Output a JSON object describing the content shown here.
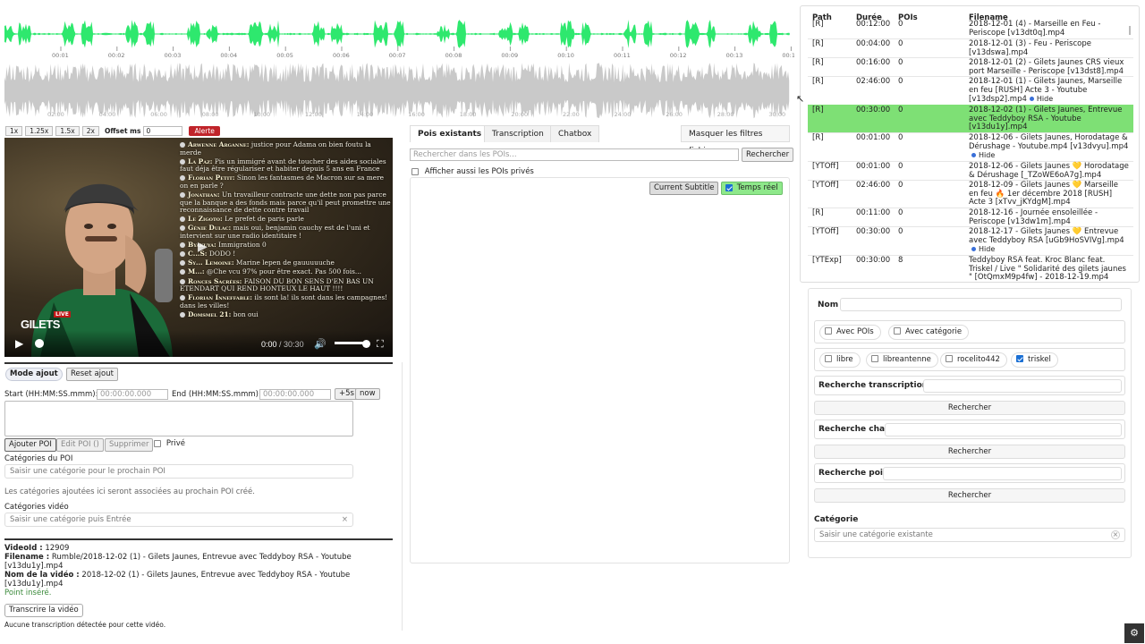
{
  "waveform": {
    "colors": {
      "top": "#2ee86e",
      "bottom": "#c9c9c9"
    },
    "top_ticks": [
      "00:01",
      "00:02",
      "00:03",
      "00:04",
      "00:05",
      "00:06",
      "00:07",
      "00:08",
      "00:09",
      "00:10",
      "00:11",
      "00:12",
      "00:13",
      "00:1"
    ],
    "bottom_ticks": [
      "02:00",
      "04:00",
      "06:00",
      "08:00",
      "10:00",
      "12:00",
      "14:00",
      "16:00",
      "18:00",
      "20:00",
      "22:00",
      "24:00",
      "26:00",
      "28:00",
      "30:00"
    ]
  },
  "speed_bar": {
    "speeds": [
      "1x",
      "1.25x",
      "1.5x",
      "2x"
    ],
    "offset_label": "Offset ms",
    "offset_value": "0",
    "alert_label": "Alerte"
  },
  "video": {
    "chat": [
      {
        "user": "Arwenne Arganne:",
        "text": "justice pour Adama on bien foutu la merde"
      },
      {
        "user": "La Paz:",
        "text": "Pis un immigré avant de toucher des aides sociales faut déja être régulariser et habiter depuis 5 ans en France"
      },
      {
        "user": "Florian Petit:",
        "text": "Sinon les fantasmes de Macron sur sa mere on en parle ?"
      },
      {
        "user": "Jonathan:",
        "text": "Un travailleur contracte une dette non pas parce que la banque a des fonds mais parce qu'il peut promettre une reconnaissance de dette contre travail"
      },
      {
        "user": "Le Zigoto:",
        "text": "Le prefet de paris parle"
      },
      {
        "user": "Génie Dulac:",
        "text": "mais oui, benjamin cauchy est de l'uni et intervient sur une radio identitaire !"
      },
      {
        "user": "Byakuya:",
        "text": "Immigration 0"
      },
      {
        "user": "C...S:",
        "text": "DODO !"
      },
      {
        "user": "Sy... Lemoine:",
        "text": "Marine lepen de gauuuuuche"
      },
      {
        "user": "M...:",
        "text": "@Che vcu 97% pour être exact. Pas 500 fois..."
      },
      {
        "user": "Ronces Sacrées:",
        "text": "FAISON DU BON SENS D'EN BAS UN ETENDART QUI REND HONTEUX LE HAUT !!!!"
      },
      {
        "user": "Florian Inneffable:",
        "text": "ils sont la! ils sont dans les campagnes! dans les villes!"
      },
      {
        "user": "Domsmel 21:",
        "text": "bon oui"
      }
    ],
    "overlay_title": "GILETS",
    "live_badge": "LIVE",
    "time_current": "0:00",
    "time_sep": " / ",
    "time_total": "30:30"
  },
  "form": {
    "mode_label": "Mode ajout",
    "reset_label": "Reset ajout",
    "start_label": "Start (HH:MM:SS.mmm):",
    "start_placeholder": "00:00:00.000",
    "end_label": "End (HH:MM:SS.mmm):",
    "end_placeholder": "00:00:00.000",
    "plus5_label": "+5s",
    "now_label": "now",
    "add_poi_label": "Ajouter POI",
    "edit_poi_label": "Edit POI ()",
    "delete_label": "Supprimer",
    "private_label": "Privé",
    "poi_categories_label": "Catégories du POI",
    "poi_categories_placeholder": "Saisir une catégorie pour le prochain POI",
    "poi_categories_hint": "Les catégories ajoutées ici seront associées au prochain POI créé.",
    "video_categories_label": "Catégories vidéo",
    "video_categories_placeholder": "Saisir une catégorie puis Entrée"
  },
  "info": {
    "video_id_label": "VideoId :",
    "video_id": "12909",
    "filename_label": "Filename :",
    "filename": "Rumble/2018-12-02 (1) - Gilets Jaunes, Entrevue avec Teddyboy RSA - Youtube [v13du1y].mp4",
    "video_name_label": "Nom de la vidéo :",
    "video_name": "2018-12-02 (1) - Gilets Jaunes, Entrevue avec Teddyboy RSA - Youtube [v13du1y].mp4",
    "point_inserted": "Point inséré.",
    "transcribe_label": "Transcrire la vidéo",
    "no_transcription": "Aucune transcription détectée pour cette vidéo."
  },
  "middle": {
    "tabs": [
      "Pois existants",
      "Transcription",
      "Chatbox"
    ],
    "hide_filters_label": "Masquer les filtres fichiers",
    "search_placeholder": "Rechercher dans les POIs...",
    "search_button": "Rechercher",
    "show_private_label": "Afficher aussi les POIs privés",
    "current_subtitle_label": "Current Subtitle",
    "realtime_label": "Temps réel"
  },
  "table": {
    "headers": [
      "Path",
      "Durée",
      "POIs",
      "Filename"
    ],
    "rows": [
      {
        "path": "[R]",
        "duration": "00:12:00",
        "pois": "0",
        "filename": "2018-12-01 (4) - Marseille en Feu - Periscope [v13dt0q].mp4",
        "hide": false
      },
      {
        "path": "[R]",
        "duration": "00:04:00",
        "pois": "0",
        "filename": "2018-12-01 (3) - Feu - Periscope [v13dswa].mp4",
        "hide": false
      },
      {
        "path": "[R]",
        "duration": "00:16:00",
        "pois": "0",
        "filename": "2018-12-01 (2) - Gilets Jaunes CRS vieux port Marseille - Periscope [v13dst8].mp4",
        "hide": false
      },
      {
        "path": "[R]",
        "duration": "02:46:00",
        "pois": "0",
        "filename": "2018-12-01 (1) - Gilets Jaunes, Marseille en feu [RUSH] Acte 3 - Youtube [v13dsp2].mp4",
        "hide": true
      },
      {
        "path": "[R]",
        "duration": "00:30:00",
        "pois": "0",
        "filename": "2018-12-02 (1) - Gilets Jaunes, Entrevue avec Teddyboy RSA - Youtube [v13du1y].mp4",
        "hide": false,
        "selected": true
      },
      {
        "path": "[R]",
        "duration": "00:01:00",
        "pois": "0",
        "filename": "2018-12-06 - Gilets Jaunes, Horodatage & Dérushage - Youtube.mp4 [v13dvyu].mp4",
        "hide": true
      },
      {
        "path": "[YTOff]",
        "duration": "00:01:00",
        "pois": "0",
        "filename": "2018-12-06 - Gilets Jaunes 💛 Horodatage & Dérushage [_TZoWE6oA7g].mp4",
        "hide": false
      },
      {
        "path": "[YTOff]",
        "duration": "02:46:00",
        "pois": "0",
        "filename": "2018-12-09 - Gilets Jaunes 💛 Marseille en feu 🔥 1er décembre 2018 [RUSH] Acte 3 [xTvv_jKYdgM].mp4",
        "hide": false
      },
      {
        "path": "[R]",
        "duration": "00:11:00",
        "pois": "0",
        "filename": "2018-12-16 - Journée ensoleillée - Periscope [v13dw1m].mp4",
        "hide": false
      },
      {
        "path": "[YTOff]",
        "duration": "00:30:00",
        "pois": "0",
        "filename": "2018-12-17 - Gilets Jaunes 💛 Entrevue avec Teddyboy RSA [uGb9HoSVIVg].mp4",
        "hide": true
      },
      {
        "path": "[YTExp]",
        "duration": "00:30:00",
        "pois": "8",
        "filename": "Teddyboy RSA feat. Kroc Blanc feat. Triskel / Live \" Solidarité des gilets jaunes \" [OtQmxM9p4fw] - 2018-12-19.mp4",
        "hide": false
      }
    ],
    "hide_label": "Hide"
  },
  "filters": {
    "name_label": "Nom",
    "avec_pois": "Avec POIs",
    "avec_categorie": "Avec catégorie",
    "sources": [
      {
        "label": "libre",
        "checked": false
      },
      {
        "label": "libreantenne",
        "checked": false
      },
      {
        "label": "rocelito442",
        "checked": false
      },
      {
        "label": "triskel",
        "checked": true
      }
    ],
    "transcriptions_label": "Recherche transcriptions",
    "chat_label": "Recherche chat",
    "pois_label": "Recherche pois",
    "search_button": "Rechercher",
    "category_label": "Catégorie",
    "category_placeholder": "Saisir une catégorie existante"
  }
}
